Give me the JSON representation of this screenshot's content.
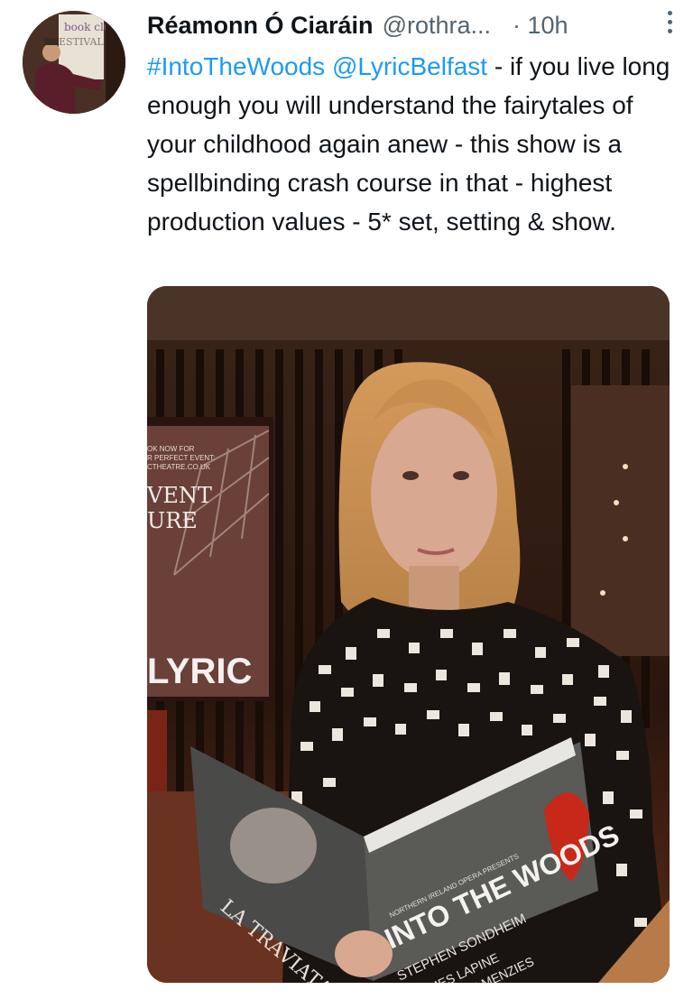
{
  "tweet": {
    "author_name": "Réamonn Ó Ciaráin",
    "author_handle": "@rothra...",
    "time": "· 10h",
    "hashtag": "#IntoTheWoods",
    "mention": "@LyricBelfast",
    "body": " - if you live long enough you will understand the fairytales of your childhood again anew - this show is a spellbinding crash course in that - highest production values - 5* set, setting & show."
  },
  "avatar": {
    "sign_line1": "book club",
    "sign_line2": "ESTIVAL"
  },
  "photo": {
    "poster_line1": "VENT",
    "poster_line2": "URE",
    "poster_small1": "OK NOW FOR",
    "poster_small2": "R PERFECT EVENT:",
    "poster_small3": "CTHEATRE.CO.UK",
    "venue_logo": "LYRIC",
    "programme_title": "INTO THE WOODS",
    "programme_presents": "NORTHERN IRELAND OPERA PRESENTS",
    "programme_credit1": "STEPHEN SONDHEIM",
    "programme_credit2": "JAMES LAPINE",
    "programme_credit3": "CAMERON MENZIES",
    "other_programme": "LA TRAVIATA"
  },
  "colors": {
    "link": "#1d9bf0",
    "muted": "#536471",
    "text": "#0f1419"
  },
  "icons": {
    "more": "more-vertical-icon"
  }
}
